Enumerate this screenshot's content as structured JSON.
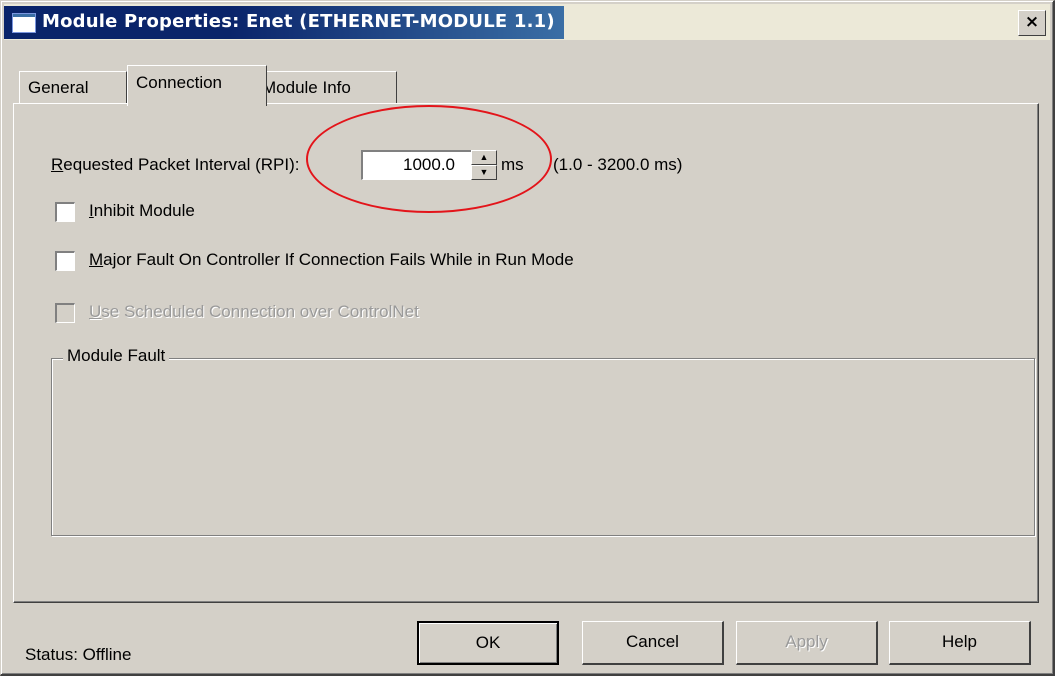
{
  "window": {
    "title": "Module Properties: Enet (ETHERNET-MODULE 1.1)",
    "close_label": "×"
  },
  "tabs": [
    {
      "label": "General"
    },
    {
      "label": "Connection"
    },
    {
      "label": "Module Info"
    }
  ],
  "connection": {
    "rpi_label_prefix": "R",
    "rpi_label_rest": "equested Packet Interval (RPI):",
    "rpi_value": "1000.0",
    "rpi_unit": "ms",
    "rpi_range": "(1.0 - 3200.0 ms)",
    "inhibit_prefix": "I",
    "inhibit_rest": "nhibit Module",
    "inhibit_checked": false,
    "major_fault_prefix": "M",
    "major_fault_rest": "ajor Fault On Controller If Connection Fails While in Run Mode",
    "major_fault_checked": false,
    "scheduled_prefix": "U",
    "scheduled_rest": "se Scheduled Connection over ControlNet",
    "scheduled_checked": false,
    "scheduled_enabled": false,
    "module_fault_title": "Module Fault"
  },
  "footer": {
    "status": "Status:  Offline",
    "ok_label": "OK",
    "cancel_label": "Cancel",
    "apply_label": "Apply",
    "help_label": "Help"
  },
  "colors": {
    "title_bar": "#0a246a",
    "dialog_face": "#d4d0c8",
    "annotation": "#e3141a"
  }
}
